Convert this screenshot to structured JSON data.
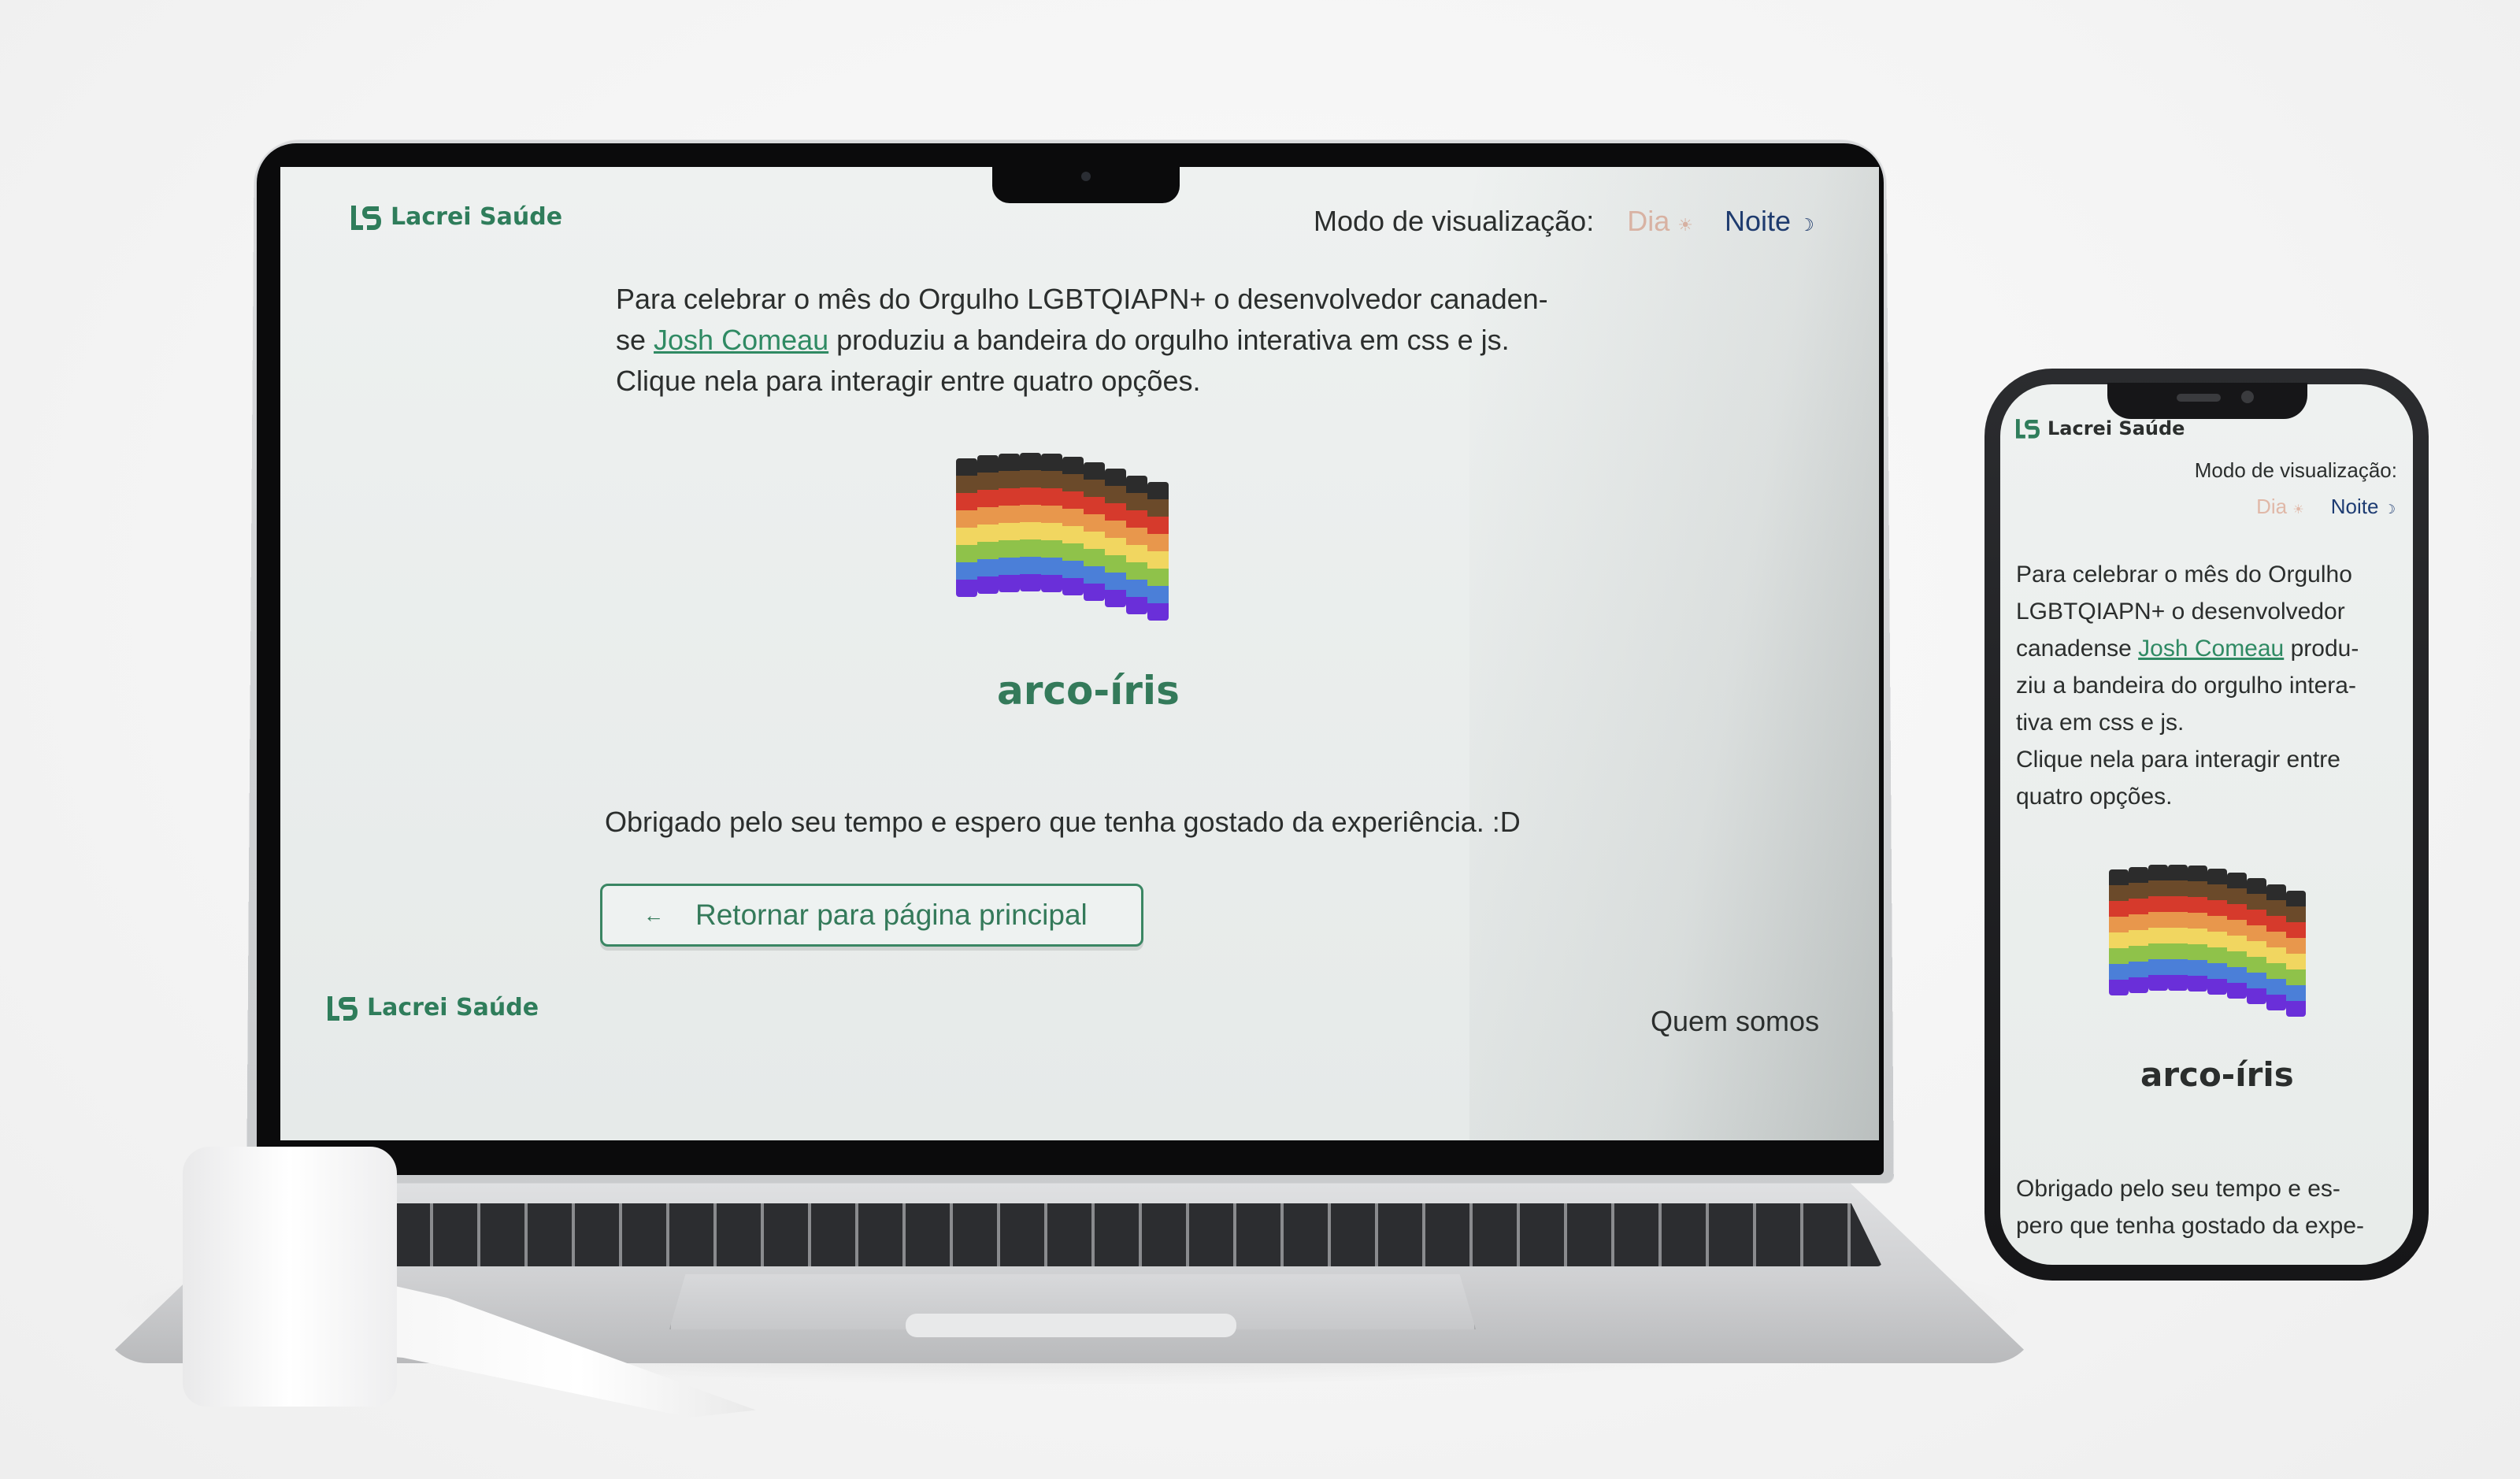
{
  "brand": {
    "name": "Lacrei Saúde",
    "color": "#2f7d5b"
  },
  "header": {
    "mode_label": "Modo de visualização:",
    "mode_day": "Dia",
    "mode_day_icon": "☀",
    "mode_night": "Noite",
    "mode_night_icon": "☽"
  },
  "intro": {
    "line1": "Para celebrar o mês do Orgulho LGBTQIAPN+ o desenvolvedor canaden-",
    "line2_before": "se ",
    "link_text": "Josh Comeau",
    "line2_after": " produziu a bandeira do orgulho interativa em css e js.",
    "line3": "Clique nela para interagir entre quatro opções."
  },
  "flag": {
    "label": "arco-íris",
    "stripes": [
      "#2c2c2c",
      "#6b4a2a",
      "#d63a2c",
      "#e8974c",
      "#f1d660",
      "#8fc24a",
      "#4b7fd8",
      "#6a2fd9"
    ]
  },
  "thanks": "Obrigado pelo seu tempo e espero que tenha gostado da experiência. :D",
  "back_button": {
    "arrow": "←",
    "label": "Retornar para página principal"
  },
  "footer": {
    "link": "Quem somos"
  },
  "phone": {
    "intro_lines": [
      "Para celebrar o mês do Orgulho",
      "LGBTQIAPN+ o desenvolvedor"
    ],
    "intro_link_before": "canadense ",
    "intro_link_after": " produ-",
    "intro_lines_after": [
      "ziu a bandeira do orgulho intera-",
      "tiva em css e js.",
      "Clique nela para interagir entre",
      "quatro opções."
    ],
    "thanks_lines": [
      "Obrigado pelo seu tempo e es-",
      "pero que tenha gostado da expe-"
    ]
  }
}
